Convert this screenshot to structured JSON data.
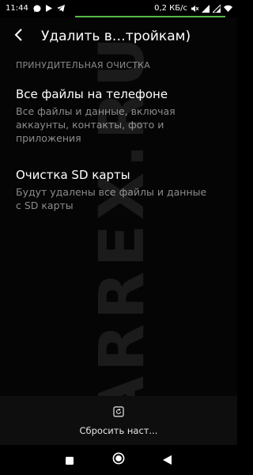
{
  "status_bar": {
    "time": "11:44",
    "network_speed": "0,2 КБ/с",
    "icons": [
      "messenger-icon",
      "play-icon",
      "telegram-icon",
      "mute-icon",
      "signal-icon",
      "signal-icon",
      "wifi-icon"
    ],
    "accent_color": "#57b848"
  },
  "app_bar": {
    "title": "Удалить в…тройкам)",
    "back_icon": "back-arrow-icon"
  },
  "section": {
    "header": "ПРИНУДИТЕЛЬНАЯ ОЧИСТКА"
  },
  "items": [
    {
      "title": "Все файлы на телефоне",
      "subtitle_lines": [
        "Все файлы и данные, включая",
        "аккаунты, контакты, фото и",
        "приложения"
      ]
    },
    {
      "title": "Очистка SD карты",
      "subtitle_lines": [
        "Будут удалены все файлы и данные",
        "с SD карты"
      ]
    }
  ],
  "watermark": {
    "text": "MARREX.RU"
  },
  "bottom_action": {
    "label": "Сбросить наст...",
    "icon": "reset-icon"
  },
  "nav_bar": {
    "icons": [
      "recent-apps-icon",
      "home-icon",
      "back-icon"
    ]
  }
}
